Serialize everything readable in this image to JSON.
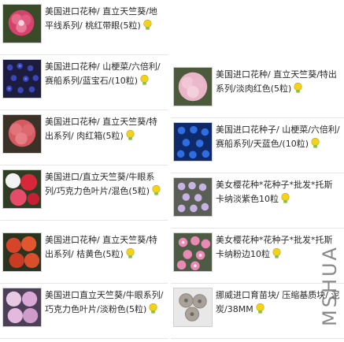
{
  "products": [
    {
      "title": "美国进口花种/ 直立天竺葵/地平线系列/ 桃红带眼(5粒)",
      "thumb": "pink-geranium",
      "icon": "bulb-icon"
    },
    {
      "title": "美国进口花种/ 山梗菜/六倍利/赛船系列/蓝宝石/(10粒)",
      "thumb": "lobelia-navy",
      "icon": "bulb-icon"
    },
    {
      "title": "美国进口花种/ 直立天竺葵/特出系列/ 肉红箱(5粒)",
      "thumb": "salmon-geranium",
      "icon": "bulb-icon"
    },
    {
      "title": "美国进口/直立天竺葵/牛眼系列/巧克力色叶片/混色(5粒)",
      "thumb": "mixed-geranium",
      "icon": "bulb-icon"
    },
    {
      "title": "美国进口花种/ 直立天竺葵/特出系列/ 桔黄色(5粒)",
      "thumb": "orange-geranium",
      "icon": "bulb-icon"
    },
    {
      "title": "美国进口直立天竺葵/牛眼系列/巧克力色叶片/淡粉色(5粒)",
      "thumb": "light-pink-geranium",
      "icon": "bulb-icon"
    },
    {
      "title": "美国进口花种/ 直立天竺葵/特出系列/淡肉红色(5粒)",
      "thumb": "pale-pink-geranium",
      "icon": "bulb-icon"
    },
    {
      "title": "美国进口花种子/ 山梗菜/六倍利/赛船系列/天蓝色/(10粒)",
      "thumb": "lobelia-blue",
      "icon": "bulb-icon"
    },
    {
      "title": "美女樱花种*花种子*批发*托斯卡纳淡紫色10粒",
      "thumb": "verbena-lilac",
      "icon": "bulb-icon"
    },
    {
      "title": "美女樱花种*花种子*批发*托斯卡纳粉边10粒",
      "thumb": "verbena-pink",
      "icon": "bulb-icon"
    },
    {
      "title": "挪威进口育苗块/ 压缩基质块/ 泥炭/38MM",
      "thumb": "peat-pellets",
      "icon": "bulb-icon"
    }
  ],
  "watermark": "MSHUA",
  "colors": {
    "title": "#2a2a2a",
    "divider": "#e6e6e6",
    "bulb": "#f2d21b",
    "bulbBase": "#8cbf3f"
  }
}
